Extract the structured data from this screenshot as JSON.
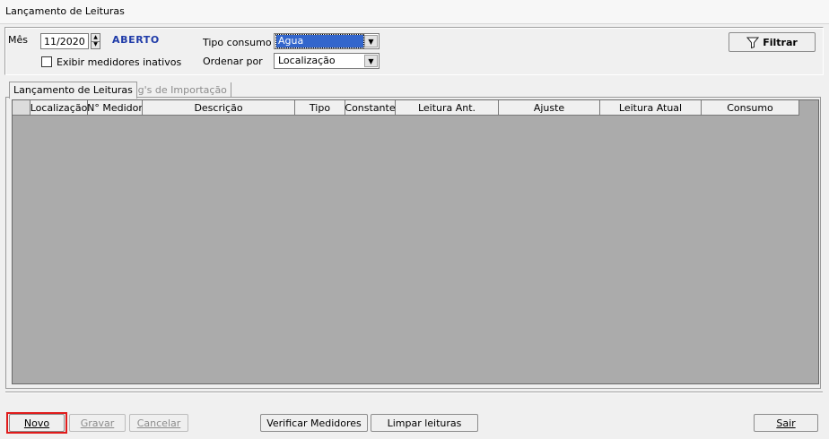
{
  "window": {
    "title": "Lançamento de Leituras"
  },
  "filters": {
    "month_label": "Mês",
    "month_value": "11/2020",
    "status": "ABERTO",
    "show_inactive_label": "Exibir medidores inativos",
    "show_inactive_checked": false,
    "consumption_type_label": "Tipo consumo",
    "consumption_type_value": "Agua",
    "order_by_label": "Ordenar por",
    "order_by_value": "Localização",
    "filter_button": "Filtrar"
  },
  "tabs": [
    {
      "label": "Lançamento de Leituras",
      "active": true
    },
    {
      "label": "Log's de Importação",
      "active": false
    }
  ],
  "grid": {
    "columns": [
      "",
      "Localização",
      "N° Medidor",
      "Descrição",
      "Tipo",
      "Constante",
      "Leitura Ant.",
      "Ajuste",
      "Leitura Atual",
      "Consumo"
    ],
    "rows": []
  },
  "footer": {
    "new": "Novo",
    "save": "Gravar",
    "cancel": "Cancelar",
    "check_meters": "Verificar Medidores",
    "clear_readings": "Limpar leituras",
    "exit": "Sair"
  }
}
